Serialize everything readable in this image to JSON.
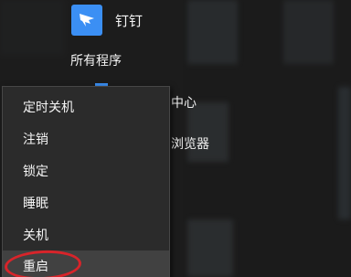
{
  "start_menu": {
    "app": {
      "label": "钉钉",
      "icon": "dingtalk-icon",
      "icon_color": "#3b8ff4"
    },
    "all_programs_label": "所有程序",
    "background_items": [
      {
        "label": "中心"
      },
      {
        "label": "浏览器"
      }
    ]
  },
  "power_menu": {
    "items": [
      {
        "label": "定时关机"
      },
      {
        "label": "注销"
      },
      {
        "label": "锁定"
      },
      {
        "label": "睡眠"
      },
      {
        "label": "关机"
      },
      {
        "label": "重启",
        "highlighted": true
      }
    ]
  },
  "annotation": {
    "color": "#d8242a"
  }
}
